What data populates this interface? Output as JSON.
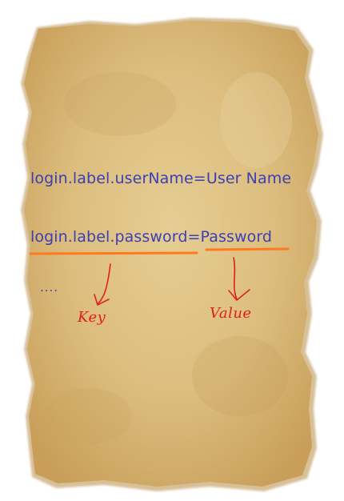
{
  "lines": [
    {
      "text": "login.label.userName=User Name"
    },
    {
      "key": "login.label.password=",
      "value": "Password"
    }
  ],
  "ellipsis": "....",
  "annotations": {
    "key_label": "Key",
    "value_label": "Value"
  },
  "colors": {
    "text": "#3b3fb4",
    "underline": "#ff7a1f",
    "annotation": "#e0201c",
    "paper": "#d9b877",
    "paper_edge": "#c39a52"
  }
}
